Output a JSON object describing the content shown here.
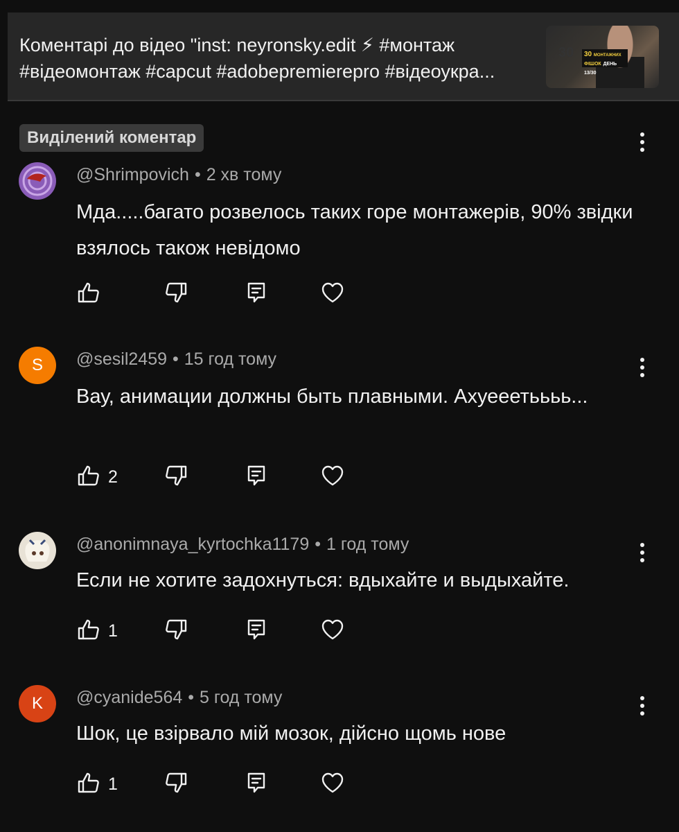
{
  "video": {
    "title": "Коментарі до відео \"inst: neyronsky.edit ⚡ #монтаж #відеомонтаж #capcut #adobepremierepro #відеоукра...",
    "thumbnail": {
      "badge_number": "30",
      "badge_line1": "МОНТАЖНИХ",
      "badge_line2": "ФІШОК",
      "badge_day": "ДЕНЬ 13/30"
    }
  },
  "highlighted_label": "Виділений коментар",
  "comments": [
    {
      "author": "@Shrimpovich",
      "time": "2 хв тому",
      "text": "Мда.....багато розвелось таких горе монтажерів, 90% звідки взялось також невідомо",
      "likes": "",
      "avatar_type": "image",
      "avatar_letter": "",
      "avatar_color": "#7a4ea0"
    },
    {
      "author": "@sesil2459",
      "time": "15 год тому",
      "text": "Вау, анимации должны быть плавными. Ахуееетьььь...",
      "likes": "2",
      "avatar_type": "letter",
      "avatar_letter": "S",
      "avatar_color": "#f57c00"
    },
    {
      "author": "@anonimnaya_kyrtochka1179",
      "time": "1 год тому",
      "text": "Если не хотите задохнуться: вдыхайте и выдыхайте.",
      "likes": "1",
      "avatar_type": "image",
      "avatar_letter": "",
      "avatar_color": "#e8e2d6"
    },
    {
      "author": "@cyanide564",
      "time": "5 год тому",
      "text": "Шок, це взірвало мій мозок, дійсно щомь нове",
      "likes": "1",
      "avatar_type": "letter",
      "avatar_letter": "K",
      "avatar_color": "#d84315"
    }
  ],
  "icons": {
    "like": "thumb-up-icon",
    "dislike": "thumb-down-icon",
    "reply": "reply-icon",
    "heart": "heart-icon",
    "more": "more-vert-icon"
  },
  "colors": {
    "background": "#0f0f0f",
    "header": "#272727",
    "meta_text": "#aaaaaa"
  }
}
